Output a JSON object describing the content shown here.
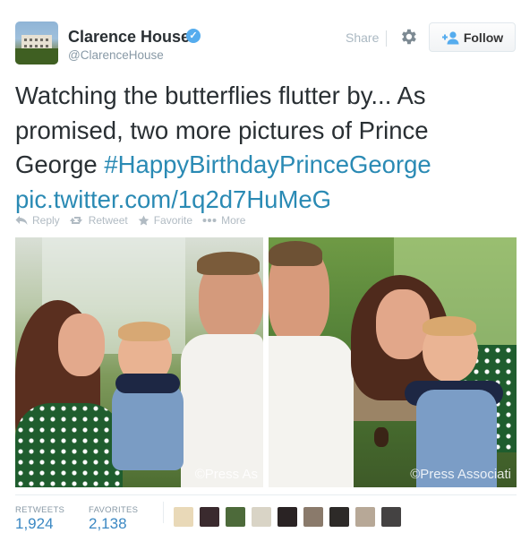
{
  "header": {
    "name": "Clarence House",
    "handle": "@ClarenceHouse",
    "share_label": "Share",
    "follow_label": "Follow",
    "verified": true
  },
  "tweet": {
    "text_plain": "Watching the butterflies flutter by... As promised, two more pictures of Prince George ",
    "hashtag": "#HappyBirthdayPrinceGeorge",
    "link": "pic.twitter.com/1q2d7HuMeG"
  },
  "actions": [
    {
      "label": "Reply",
      "icon": "reply-icon"
    },
    {
      "label": "Retweet",
      "icon": "retweet-icon"
    },
    {
      "label": "Favorite",
      "icon": "star-icon"
    },
    {
      "label": "More",
      "icon": "more-icon"
    }
  ],
  "photos": {
    "left_watermark": "©Press As",
    "right_watermark": "©Press Associati"
  },
  "stats": {
    "retweets_label": "RETWEETS",
    "retweets_value": "1,924",
    "favorites_label": "FAVORITES",
    "favorites_value": "2,138"
  },
  "colors": {
    "link": "#2a8ab4",
    "verified": "#55acee",
    "muted": "#8899a6"
  }
}
